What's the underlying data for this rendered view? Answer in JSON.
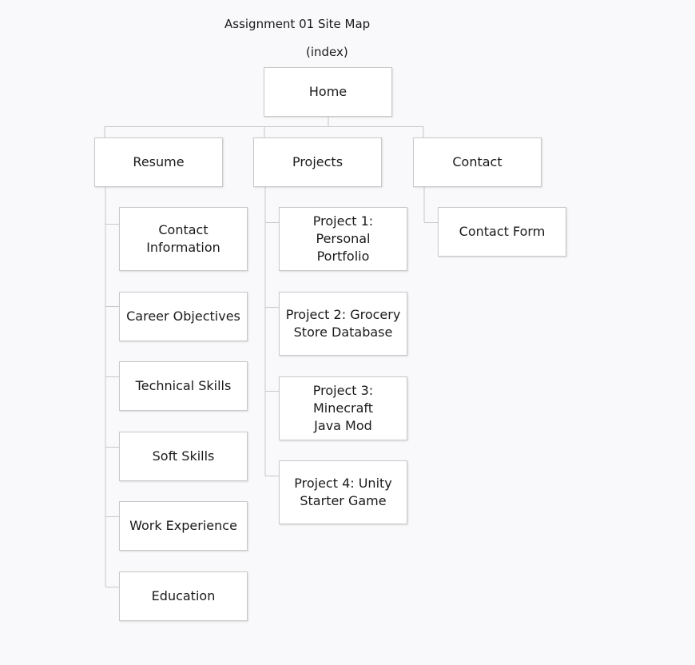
{
  "title": "Assignment 01 Site Map",
  "root": {
    "caption": "(index)",
    "label": "Home"
  },
  "sections": [
    {
      "label": "Resume",
      "children": [
        "Contact\nInformation",
        "Career Objectives",
        "Technical Skills",
        "Soft Skills",
        "Work Experience",
        "Education"
      ]
    },
    {
      "label": "Projects",
      "children": [
        "Project 1: Personal\nPortfolio",
        "Project 2: Grocery\nStore Database",
        "Project 3: Minecraft\nJava Mod",
        "Project 4: Unity\nStarter Game"
      ]
    },
    {
      "label": "Contact",
      "children": [
        "Contact Form"
      ]
    }
  ],
  "colors": {
    "connector": "#c8c8c8",
    "node_border": "#c8c8c8",
    "background": "#f9f9fb"
  }
}
